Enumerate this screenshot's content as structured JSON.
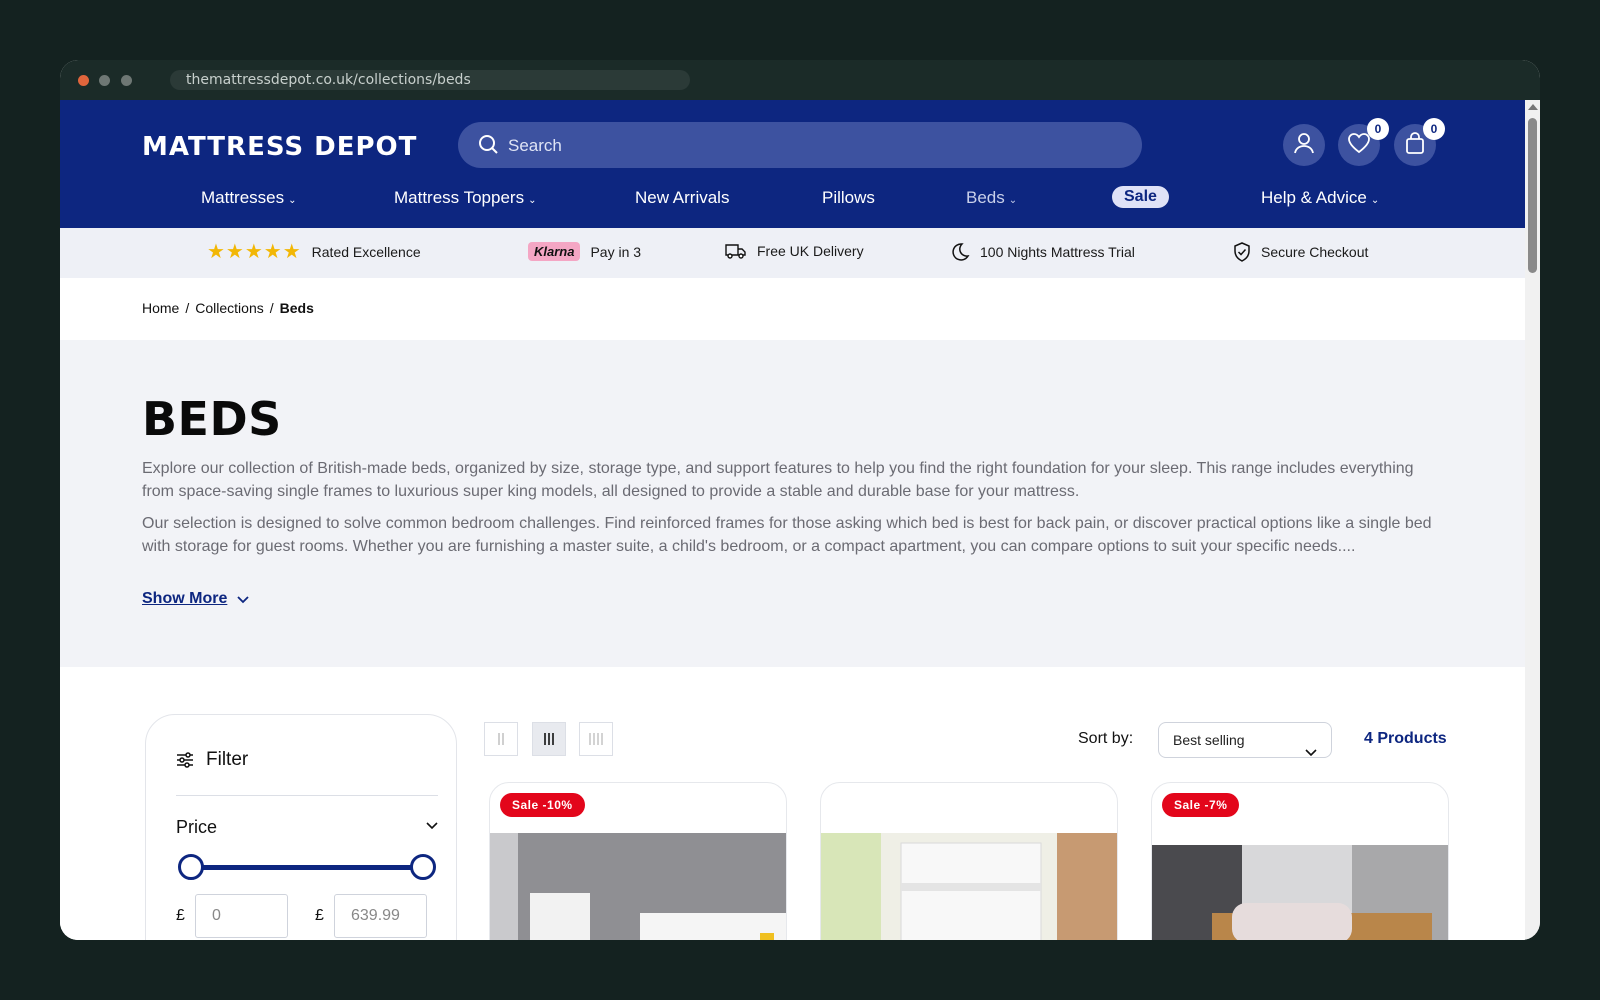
{
  "browser": {
    "url": "themattressdepot.co.uk/collections/beds"
  },
  "header": {
    "logo_text": "MATTRESS DEPOT",
    "search_placeholder": "Search",
    "wishlist_count": "0",
    "cart_count": "0",
    "nav": [
      {
        "label": "Mattresses"
      },
      {
        "label": "Mattress Toppers"
      },
      {
        "label": "New Arrivals"
      },
      {
        "label": "Pillows"
      },
      {
        "label": "Beds"
      },
      {
        "label": "Sale"
      },
      {
        "label": "Help & Advice"
      }
    ]
  },
  "trust": {
    "stars": "★★★★★",
    "rated": "Rated Excellence",
    "klarna": "Klarna",
    "pay": "Pay in 3",
    "delivery": "Free UK Delivery",
    "trial": "100 Nights Mattress Trial",
    "secure": "Secure Checkout"
  },
  "breadcrumb": {
    "home": "Home",
    "collections": "Collections",
    "current": "Beds",
    "sep": "/"
  },
  "hero": {
    "title": "BEDS",
    "p1": "Explore our collection of British-made beds, organized by size, storage type, and support features to help you find the right foundation for your sleep. This range includes everything from space-saving single frames to luxurious super king models, all designed to provide a stable and durable base for your mattress.",
    "p2": "Our selection is designed to solve common bedroom challenges. Find reinforced frames for those asking which bed is best for back pain, or discover practical options like a single bed with storage for guest rooms. Whether you are furnishing a master suite, a child's bedroom, or a compact apartment, you can compare options to suit your specific needs....",
    "show_more": "Show More"
  },
  "filter": {
    "title": "Filter",
    "price_title": "Price",
    "currency": "£",
    "min_placeholder": "0",
    "max_placeholder": "639.99"
  },
  "toolbar": {
    "sort_label": "Sort by:",
    "sort_value": "Best selling",
    "product_count": "4 Products"
  },
  "products": [
    {
      "badge": "Sale -10%"
    },
    {
      "badge": ""
    },
    {
      "badge": "Sale -7%"
    }
  ]
}
